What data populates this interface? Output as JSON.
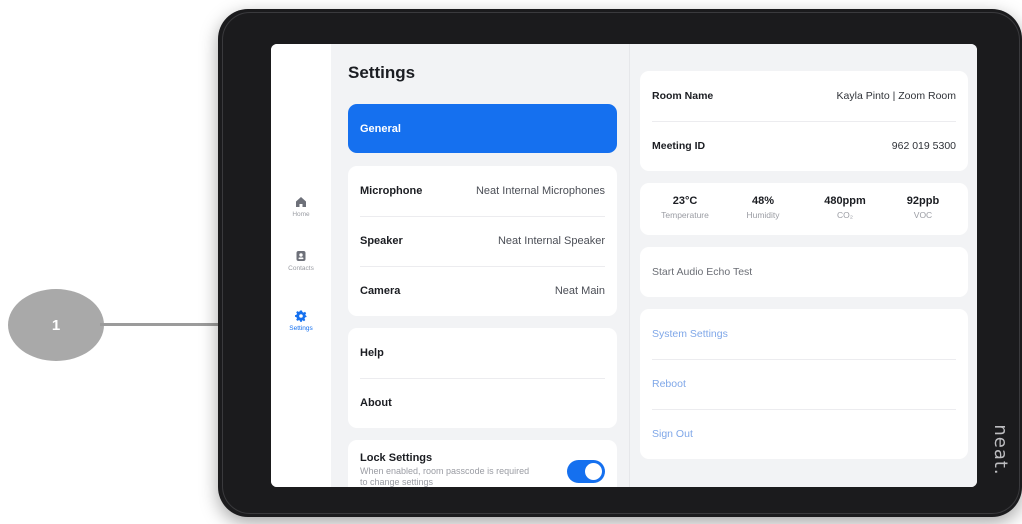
{
  "callout": {
    "number": "1"
  },
  "device": {
    "brand": "neat."
  },
  "nav": {
    "items": [
      {
        "label": "Home",
        "icon": "home-icon",
        "active": false
      },
      {
        "label": "Contacts",
        "icon": "contacts-icon",
        "active": false
      },
      {
        "label": "Settings",
        "icon": "gear-icon",
        "active": true
      }
    ]
  },
  "settings": {
    "title": "Settings",
    "general_label": "General",
    "devices": [
      {
        "label": "Microphone",
        "value": "Neat Internal Microphones"
      },
      {
        "label": "Speaker",
        "value": "Neat Internal Speaker"
      },
      {
        "label": "Camera",
        "value": "Neat Main"
      }
    ],
    "help_label": "Help",
    "about_label": "About",
    "lock": {
      "title": "Lock Settings",
      "description": "When enabled, room passcode is required to change settings",
      "enabled": true
    }
  },
  "room": {
    "name_label": "Room Name",
    "name_value": "Kayla Pinto | Zoom Room",
    "meeting_label": "Meeting ID",
    "meeting_value": "962 019 5300"
  },
  "environment": [
    {
      "value": "23°C",
      "label": "Temperature"
    },
    {
      "value": "48%",
      "label": "Humidity"
    },
    {
      "value": "480ppm",
      "label": "CO₂"
    },
    {
      "value": "92ppb",
      "label": "VOC"
    }
  ],
  "actions": {
    "echo_test": "Start Audio Echo Test",
    "system_settings": "System Settings",
    "reboot": "Reboot",
    "sign_out": "Sign Out"
  },
  "colors": {
    "accent": "#1570EF",
    "background": "#F2F3F5",
    "action_link": "#7FA7E8"
  }
}
